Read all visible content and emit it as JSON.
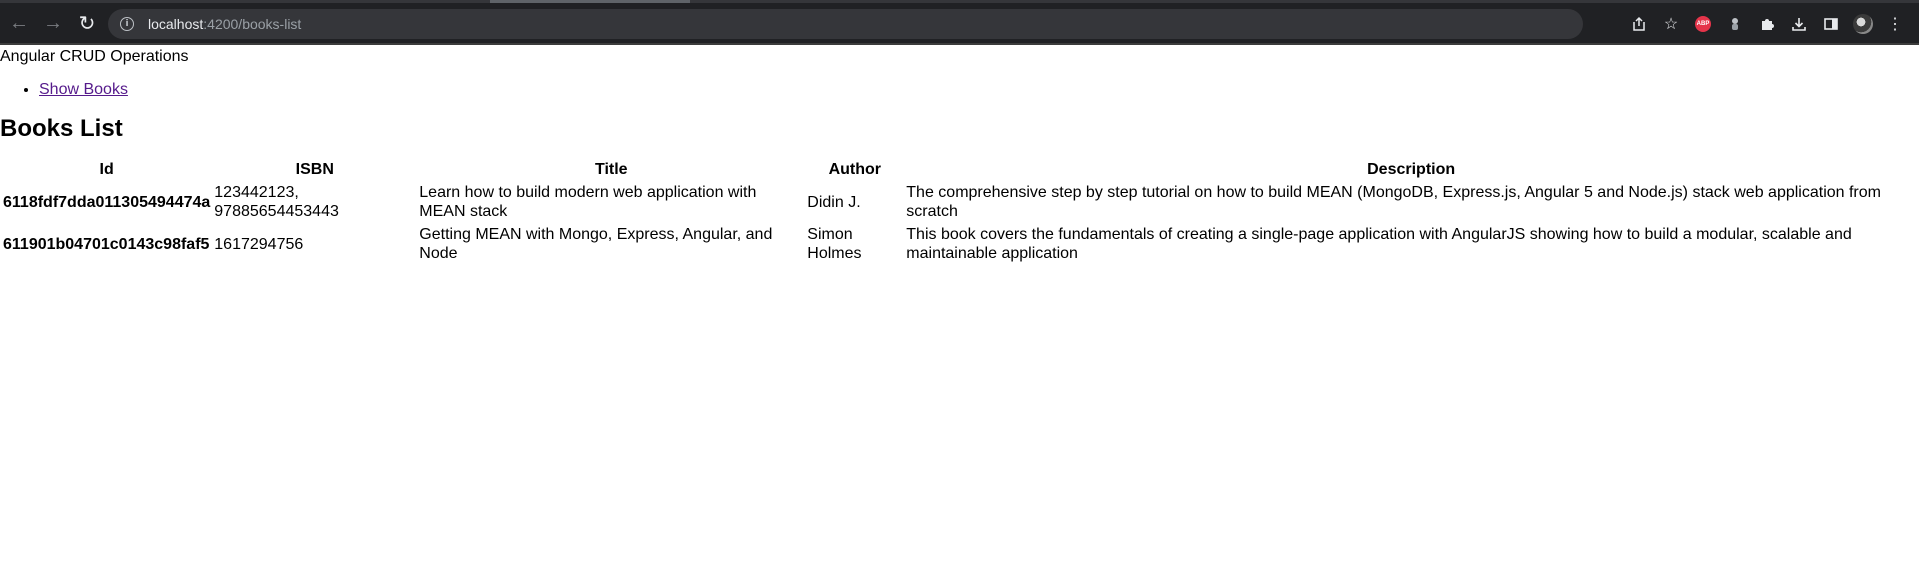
{
  "browser": {
    "url_host": "localhost",
    "url_rest": ":4200/books-list",
    "icons": [
      "back-icon",
      "forward-icon",
      "reload-icon",
      "info-icon",
      "share-icon",
      "star-icon",
      "adblock-icon",
      "extension-icon",
      "puzzle-icon",
      "download-icon",
      "sidepanel-icon",
      "avatar",
      "more-icon"
    ],
    "abp_label": "ABP"
  },
  "app": {
    "title": "Angular CRUD Operations",
    "nav": [
      {
        "label": "Show Books"
      }
    ]
  },
  "books": {
    "heading": "Books List",
    "columns": [
      "Id",
      "ISBN",
      "Title",
      "Author",
      "Description"
    ],
    "rows": [
      {
        "id": "6118fdf7dda011305494474a",
        "isbn": "123442123, 97885654453443",
        "title": "Learn how to build modern web application with MEAN stack",
        "author": "Didin J.",
        "description": "The comprehensive step by step tutorial on how to build MEAN (MongoDB, Express.js, Angular 5 and Node.js) stack web application from scratch"
      },
      {
        "id": "611901b04701c0143c98faf5",
        "isbn": "1617294756",
        "title": "Getting MEAN with Mongo, Express, Angular, and Node",
        "author": "Simon Holmes",
        "description": "This book covers the fundamentals of creating a single-page application with AngularJS showing how to build a modular, scalable and maintainable application"
      }
    ]
  }
}
